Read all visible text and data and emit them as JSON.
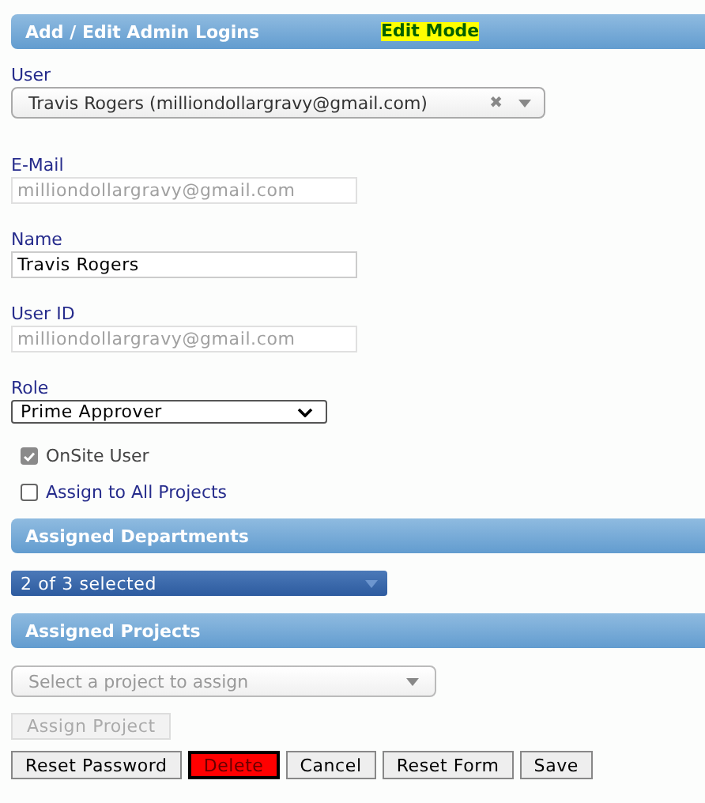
{
  "header": {
    "title": "Add / Edit Admin Logins",
    "mode_badge": "Edit Mode"
  },
  "fields": [
    {
      "kind": "combo",
      "label": "User",
      "value": "Travis Rogers (milliondollargravy@gmail.com)",
      "clear": "✖"
    },
    {
      "kind": "text",
      "label": "E-Mail",
      "value": "milliondollargravy@gmail.com",
      "disabled": true
    },
    {
      "kind": "text",
      "label": "Name",
      "value": "Travis Rogers",
      "disabled": false
    },
    {
      "kind": "text",
      "label": "User ID",
      "value": "milliondollargravy@gmail.com",
      "disabled": true
    },
    {
      "kind": "select",
      "label": "Role",
      "value": "Prime Approver"
    }
  ],
  "checkboxes": [
    {
      "label": "OnSite User",
      "checked": true,
      "disabled": true
    },
    {
      "label": "Assign to All Projects",
      "checked": false,
      "disabled": false
    }
  ],
  "departments": {
    "title": "Assigned Departments",
    "summary": "2 of 3 selected"
  },
  "projects": {
    "title": "Assigned Projects",
    "placeholder": "Select a project to assign",
    "assign_button": {
      "label": "Assign Project",
      "disabled": true
    }
  },
  "buttons": [
    {
      "label": "Reset Password",
      "kind": "default"
    },
    {
      "label": "Delete",
      "kind": "danger"
    },
    {
      "label": "Cancel",
      "kind": "default"
    },
    {
      "label": "Reset Form",
      "kind": "default"
    },
    {
      "label": "Save",
      "kind": "default"
    }
  ]
}
